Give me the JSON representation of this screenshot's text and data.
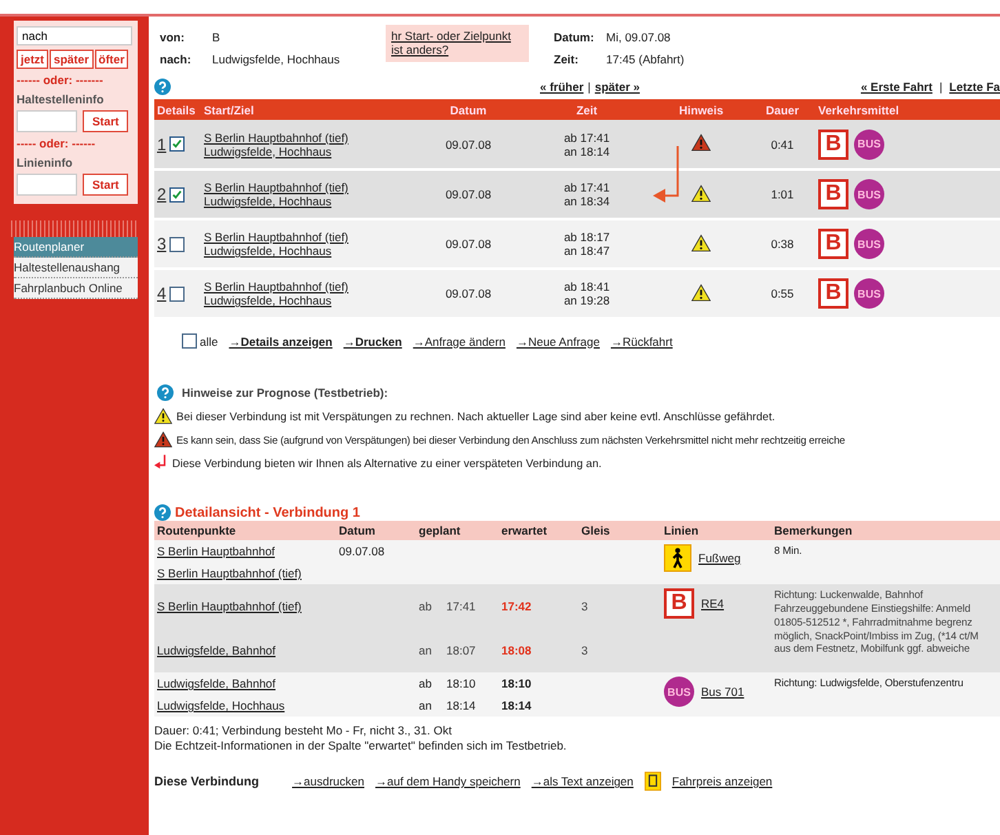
{
  "sidebar": {
    "destination_field": {
      "value": "nach"
    },
    "time_buttons": [
      "jetzt",
      "später",
      "öfter"
    ],
    "separator_1": "------ oder: -------",
    "stop_info": {
      "label": "Haltestelleninfo",
      "button": "Start"
    },
    "separator_2": "----- oder: ------",
    "line_info": {
      "label": "Linieninfo",
      "button": "Start"
    },
    "menu": [
      {
        "label": "Routenplaner",
        "selected": true
      },
      {
        "label": "Haltestellenaushang",
        "selected": false
      },
      {
        "label": "Fahrplanbuch Online",
        "selected": false
      }
    ]
  },
  "query": {
    "from_label": "von:",
    "from": "B",
    "to_label": "nach:",
    "to": "Ludwigsfelde, Hochhaus",
    "change_link": "hr Start- oder Zielpunkt ist anders?",
    "date_label": "Datum:",
    "date": "Mi, 09.07.08",
    "time_label": "Zeit:",
    "time": "17:45 (Abfahrt)"
  },
  "nav": {
    "earlier": "« früher",
    "separator_1": "|",
    "later": "später »",
    "first": "« Erste Fahrt",
    "separator_2": "|",
    "last": "Letzte Fa"
  },
  "results": {
    "columns": [
      "Details",
      "Start/Ziel",
      "Datum",
      "Zeit",
      "Hinweis",
      "Dauer",
      "Verkehrsmittel"
    ],
    "rows": [
      {
        "number": "1",
        "checked": true,
        "start": "S Berlin Hauptbahnhof (tief)",
        "destination": "Ludwigsfelde, Hochhaus",
        "date": "09.07.08",
        "departure": "ab 17:41",
        "arrival": "an 18:14",
        "severe": true,
        "alternative": false,
        "duration": "0:41",
        "transport": [
          {
            "kind": "train",
            "label": "B"
          },
          {
            "kind": "bus",
            "label": "BUS"
          }
        ]
      },
      {
        "number": "2",
        "checked": true,
        "start": "S Berlin Hauptbahnhof (tief)",
        "destination": "Ludwigsfelde, Hochhaus",
        "date": "09.07.08",
        "departure": "ab 17:41",
        "arrival": "an 18:34",
        "severe": false,
        "alternative": true,
        "duration": "1:01",
        "transport": [
          {
            "kind": "train",
            "label": "B"
          },
          {
            "kind": "bus",
            "label": "BUS"
          }
        ]
      },
      {
        "number": "3",
        "checked": false,
        "start": "S Berlin Hauptbahnhof (tief)",
        "destination": "Ludwigsfelde, Hochhaus",
        "date": "09.07.08",
        "departure": "ab 18:17",
        "arrival": "an 18:47",
        "severe": false,
        "alternative": false,
        "duration": "0:38",
        "transport": [
          {
            "kind": "train",
            "label": "B"
          },
          {
            "kind": "bus",
            "label": "BUS"
          }
        ]
      },
      {
        "number": "4",
        "checked": false,
        "start": "S Berlin Hauptbahnhof (tief)",
        "destination": "Ludwigsfelde, Hochhaus",
        "date": "09.07.08",
        "departure": "ab 18:41",
        "arrival": "an 19:28",
        "severe": false,
        "alternative": false,
        "duration": "0:55",
        "transport": [
          {
            "kind": "train",
            "label": "B"
          },
          {
            "kind": "bus",
            "label": "BUS"
          }
        ]
      }
    ]
  },
  "actions": {
    "select_all": {
      "label": "alle",
      "checked": false
    },
    "links": [
      {
        "label": "→Details anzeigen",
        "bold": true
      },
      {
        "label": "→Drucken",
        "bold": true
      },
      {
        "label": "→Anfrage ändern",
        "bold": false
      },
      {
        "label": "→Neue Anfrage",
        "bold": false
      },
      {
        "label": "→Rückfahrt",
        "bold": false
      }
    ]
  },
  "notes": {
    "title": "Hinweise zur Prognose (Testbetrieb):",
    "items": [
      {
        "kind": "minor",
        "text": "Bei dieser Verbindung ist mit Verspätungen zu rechnen. Nach aktueller Lage sind aber keine evtl. Anschlüsse gefährdet."
      },
      {
        "kind": "severe",
        "text": "Es kann sein, dass Sie (aufgrund von Verspätungen) bei dieser Verbindung den Anschluss zum nächsten Verkehrsmittel nicht mehr rechtzeitig erreiche"
      },
      {
        "kind": "alternative",
        "text": "Diese Verbindung bieten wir Ihnen als Alternative zu einer verspäteten Verbindung an."
      }
    ]
  },
  "detail": {
    "title": "Detailansicht - Verbindung  1",
    "columns": [
      "Routenpunkte",
      "Datum",
      "geplant",
      "erwartet",
      "Gleis",
      "Linien",
      "Bemerkungen"
    ],
    "legs": [
      {
        "kind": "walk",
        "line": "Fußweg",
        "remarks": [
          "8 Min."
        ],
        "stops": [
          {
            "name": "S Berlin Hauptbahnhof",
            "date": "09.07.08"
          },
          {
            "name": "S Berlin Hauptbahnhof (tief)"
          }
        ]
      },
      {
        "kind": "train",
        "badge": "B",
        "line": "RE4",
        "remarks": [
          "Richtung: Luckenwalde, Bahnhof",
          "Fahrzeuggebundene Einstiegshilfe: Anmeld",
          "01805-512512 *, Fahrradmitnahme begrenz",
          "möglich, SnackPoint/Imbiss im Zug, (*14 ct/M",
          "aus dem Festnetz, Mobilfunk ggf. abweiche"
        ],
        "stops": [
          {
            "name": "S Berlin Hauptbahnhof (tief)",
            "type": "ab",
            "planned": "17:41",
            "expected": "17:42",
            "delayed": true,
            "platform": "3"
          },
          {
            "name": "Ludwigsfelde, Bahnhof",
            "type": "an",
            "planned": "18:07",
            "expected": "18:08",
            "delayed": true,
            "platform": "3"
          }
        ]
      },
      {
        "kind": "bus",
        "badge": "BUS",
        "line": "Bus 701",
        "remarks": [
          "Richtung: Ludwigsfelde, Oberstufenzentru"
        ],
        "stops": [
          {
            "name": "Ludwigsfelde, Bahnhof",
            "type": "ab",
            "planned": "18:10",
            "expected": "18:10",
            "delayed": false
          },
          {
            "name": "Ludwigsfelde, Hochhaus",
            "type": "an",
            "planned": "18:14",
            "expected": "18:14",
            "delayed": false
          }
        ]
      }
    ],
    "notes": [
      "Dauer: 0:41; Verbindung besteht Mo - Fr, nicht 3., 31. Okt",
      "Die Echtzeit-Informationen in der Spalte \"erwartet\" befinden sich im Testbetrieb."
    ]
  },
  "footer": {
    "label": "Diese Verbindung",
    "links": [
      "→ausdrucken",
      "→auf dem Handy speichern",
      "→als Text anzeigen"
    ],
    "fare_link": "Fahrpreis anzeigen"
  }
}
